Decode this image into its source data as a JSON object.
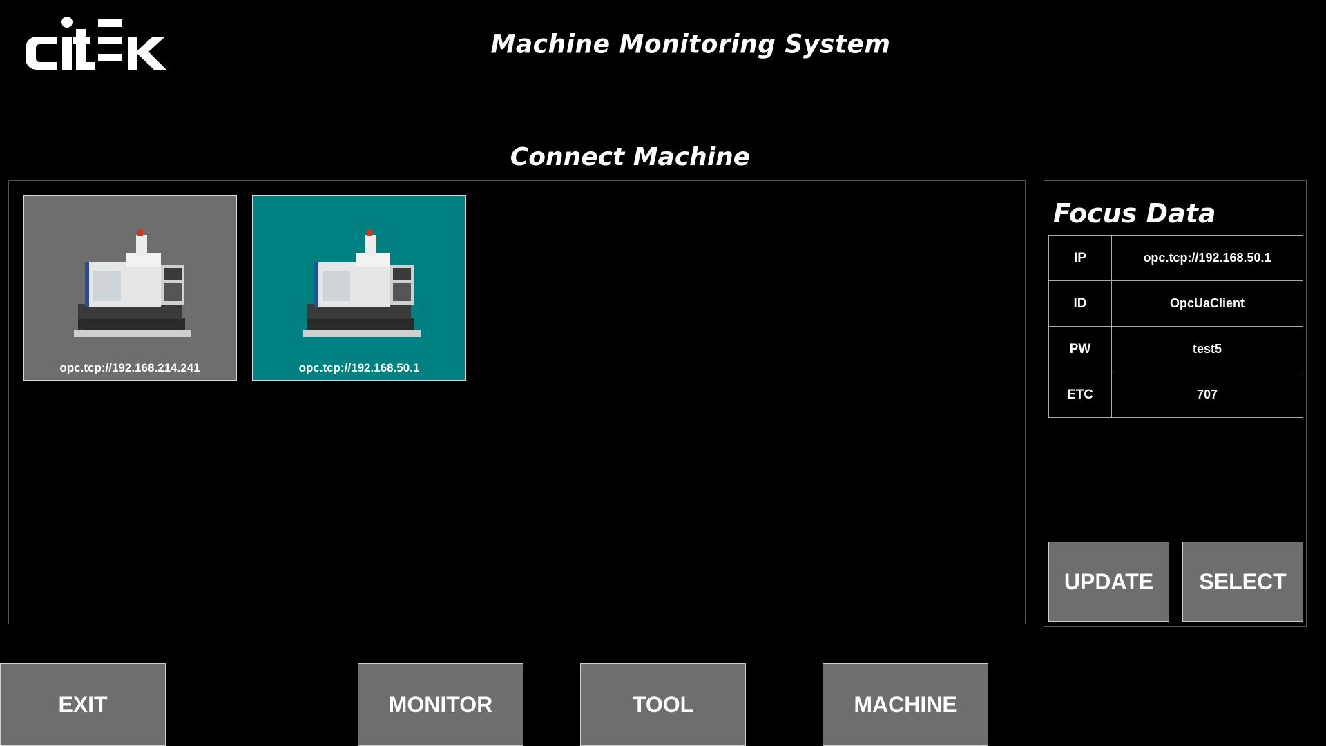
{
  "header": {
    "logo_text": "CITEK",
    "title": "Machine Monitoring System"
  },
  "connect": {
    "title": "Connect Machine",
    "machines": [
      {
        "label": "opc.tcp://192.168.214.241",
        "state": "inactive"
      },
      {
        "label": "opc.tcp://192.168.50.1",
        "state": "active"
      }
    ]
  },
  "focus": {
    "title": "Focus Data",
    "rows": [
      {
        "key": "IP",
        "value": "opc.tcp://192.168.50.1"
      },
      {
        "key": "ID",
        "value": "OpcUaClient"
      },
      {
        "key": "PW",
        "value": "test5"
      },
      {
        "key": "ETC",
        "value": "707"
      }
    ],
    "update_label": "UPDATE",
    "select_label": "SELECT"
  },
  "nav": {
    "exit_label": "EXIT",
    "monitor_label": "MONITOR",
    "tool_label": "TOOL",
    "machine_label": "MACHINE"
  },
  "colors": {
    "background": "#000000",
    "card_inactive": "#6e6e6e",
    "card_active": "#008080",
    "button": "#6e6e6e"
  },
  "icons": {
    "logo": "citek-logo",
    "machine": "cnc-machine-icon"
  }
}
